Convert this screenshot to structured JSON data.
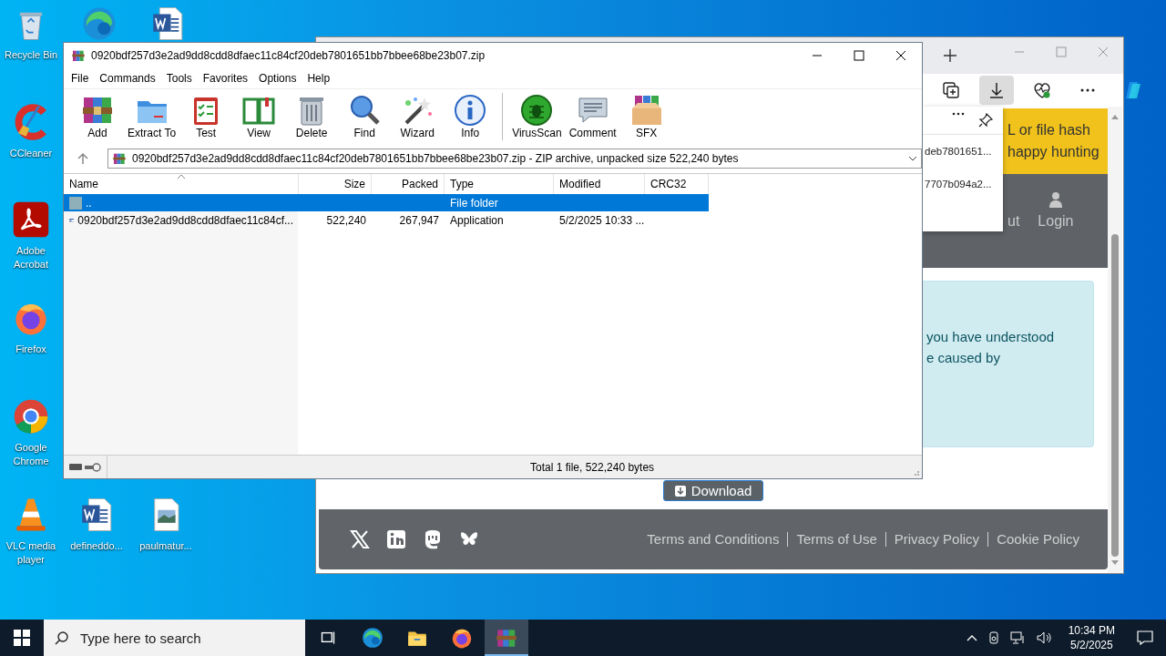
{
  "desktop_icons": [
    {
      "kind": "recycle",
      "label": "Recycle Bin"
    },
    {
      "kind": "edge"
    },
    {
      "kind": "word"
    },
    {
      "kind": "ccleaner",
      "label": "CCleaner"
    },
    {
      "kind": "acrobat",
      "label": "Adobe Acrobat"
    },
    {
      "kind": "firefox",
      "label": "Firefox"
    },
    {
      "kind": "chrome",
      "label": "Google Chrome"
    },
    {
      "kind": "vlc",
      "label": "VLC media player"
    },
    {
      "kind": "worddoc",
      "label": "defineddo..."
    },
    {
      "kind": "image",
      "label": "paulmatur..."
    }
  ],
  "browser": {
    "toolbar": [
      {
        "kind": "collections",
        "selected": false
      },
      {
        "kind": "download",
        "selected": true
      },
      {
        "kind": "health",
        "selected": false
      },
      {
        "kind": "more",
        "selected": false
      },
      {
        "kind": "copilot",
        "selected": false
      }
    ],
    "downloads": [
      "deb7801651...",
      "7707b094a2..."
    ],
    "banner": [
      "L or file hash",
      "happy hunting"
    ],
    "nav": [
      "ut",
      "Login"
    ],
    "notice": [
      "you have understood",
      "e caused by"
    ],
    "download_button": "Download",
    "footer_links": [
      "Terms and Conditions",
      "Terms of Use",
      "Privacy Policy",
      "Cookie Policy"
    ]
  },
  "winrar": {
    "title": "0920bdf257d3e2ad9dd8cdd8dfaec11c84cf20deb7801651bb7bbee68be23b07.zip",
    "menu": [
      "File",
      "Commands",
      "Tools",
      "Favorites",
      "Options",
      "Help"
    ],
    "toolbar": [
      {
        "kind": "add",
        "label": "Add"
      },
      {
        "kind": "extract",
        "label": "Extract To"
      },
      {
        "kind": "test",
        "label": "Test"
      },
      {
        "kind": "view",
        "label": "View"
      },
      {
        "kind": "delete",
        "label": "Delete"
      },
      {
        "kind": "find",
        "label": "Find"
      },
      {
        "kind": "wizard",
        "label": "Wizard"
      },
      {
        "kind": "info",
        "label": "Info"
      },
      {
        "kind": "virusscan",
        "label": "VirusScan"
      },
      {
        "kind": "comment",
        "label": "Comment"
      },
      {
        "kind": "sfx",
        "label": "SFX"
      }
    ],
    "path": "0920bdf257d3e2ad9dd8cdd8dfaec11c84cf20deb7801651bb7bbee68be23b07.zip - ZIP archive, unpacked size 522,240 bytes",
    "columns": [
      "Name",
      "Size",
      "Packed",
      "Type",
      "Modified",
      "CRC32"
    ],
    "files": [
      {
        "kind": "folder",
        "name": "..",
        "type": "File folder",
        "selected": true
      },
      {
        "kind": "app",
        "name": "0920bdf257d3e2ad9dd8cdd8dfaec11c84cf...",
        "size": "522,240",
        "packed": "267,947",
        "type": "Application",
        "modified": "5/2/2025 10:33 ...",
        "selected": false
      }
    ],
    "status": "Total 1 file, 522,240 bytes"
  },
  "taskbar": {
    "search_placeholder": "Type here to search",
    "apps": [
      {
        "kind": "taskview",
        "selected": false
      },
      {
        "kind": "edge",
        "selected": false
      },
      {
        "kind": "explorer",
        "selected": false
      },
      {
        "kind": "firefox",
        "selected": false
      },
      {
        "kind": "winrar",
        "selected": true
      }
    ],
    "time": "10:34 PM",
    "date": "5/2/2025"
  }
}
